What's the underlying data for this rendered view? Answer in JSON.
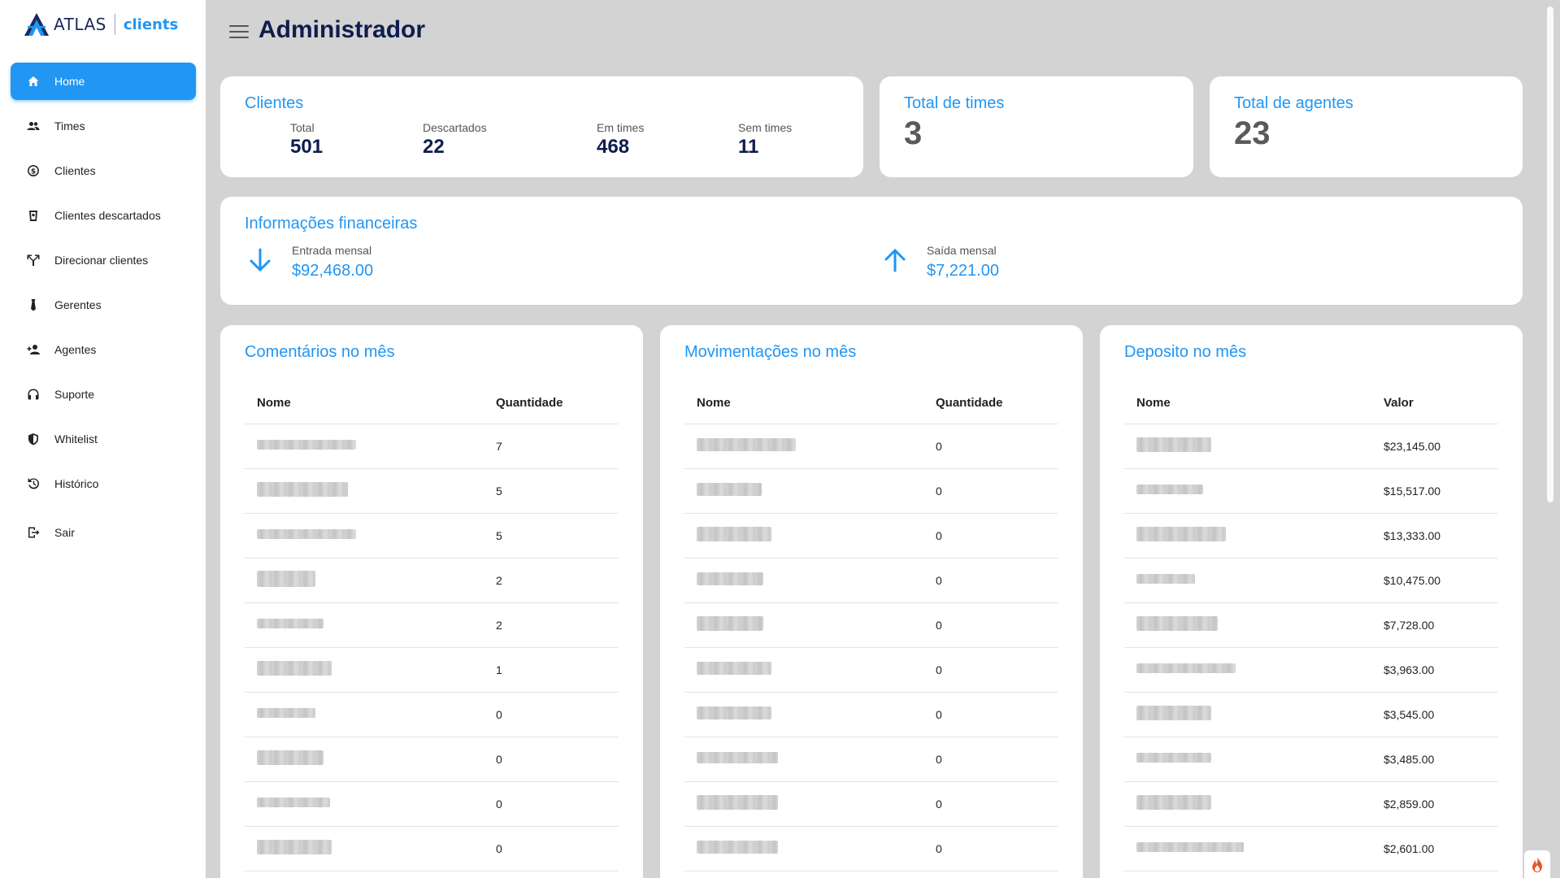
{
  "app": {
    "logo_main": "ATLAS",
    "logo_sub": "clients",
    "page_title": "Administrador"
  },
  "nav": [
    {
      "label": "Home",
      "icon": "home-icon",
      "active": true
    },
    {
      "label": "Times",
      "icon": "groups-icon"
    },
    {
      "label": "Clientes",
      "icon": "dollar-circle-icon"
    },
    {
      "label": "Clientes descartados",
      "icon": "trash-bin-icon"
    },
    {
      "label": "Direcionar clientes",
      "icon": "fork-arrow-icon"
    },
    {
      "label": "Gerentes",
      "icon": "tie-icon"
    },
    {
      "label": "Agentes",
      "icon": "person-add-icon"
    },
    {
      "label": "Suporte",
      "icon": "headset-icon"
    },
    {
      "label": "Whitelist",
      "icon": "shield-icon"
    },
    {
      "label": "Histórico",
      "icon": "history-icon"
    },
    {
      "label": "Sair",
      "icon": "logout-icon"
    }
  ],
  "clientes": {
    "title": "Clientes",
    "stats": [
      {
        "label": "Total",
        "value": "501"
      },
      {
        "label": "Descartados",
        "value": "22"
      },
      {
        "label": "Em times",
        "value": "468"
      },
      {
        "label": "Sem times",
        "value": "11"
      }
    ]
  },
  "times": {
    "title": "Total de times",
    "value": "3"
  },
  "agentes": {
    "title": "Total de agentes",
    "value": "23"
  },
  "financeiro": {
    "title": "Informações financeiras",
    "entrada": {
      "label": "Entrada mensal",
      "value": "$92,468.00",
      "icon": "arrow-down-icon"
    },
    "saida": {
      "label": "Saída mensal",
      "value": "$7,221.00",
      "icon": "arrow-up-icon"
    }
  },
  "comentarios": {
    "title": "Comentários no mês",
    "col_name": "Nome",
    "col_value": "Quantidade",
    "rows": [
      "7",
      "5",
      "5",
      "2",
      "2",
      "1",
      "0",
      "0",
      "0",
      "0"
    ]
  },
  "movimentacoes": {
    "title": "Movimentações no mês",
    "col_name": "Nome",
    "col_value": "Quantidade",
    "rows": [
      "0",
      "0",
      "0",
      "0",
      "0",
      "0",
      "0",
      "0",
      "0",
      "0"
    ]
  },
  "deposito": {
    "title": "Deposito no mês",
    "col_name": "Nome",
    "col_value": "Valor",
    "rows": [
      "$23,145.00",
      "$15,517.00",
      "$13,333.00",
      "$10,475.00",
      "$7,728.00",
      "$3,963.00",
      "$3,545.00",
      "$3,485.00",
      "$2,859.00",
      "$2,601.00"
    ]
  },
  "colors": {
    "accent": "#2196f3",
    "title_dark": "#0e1d4d",
    "background": "#d3d3d3"
  }
}
